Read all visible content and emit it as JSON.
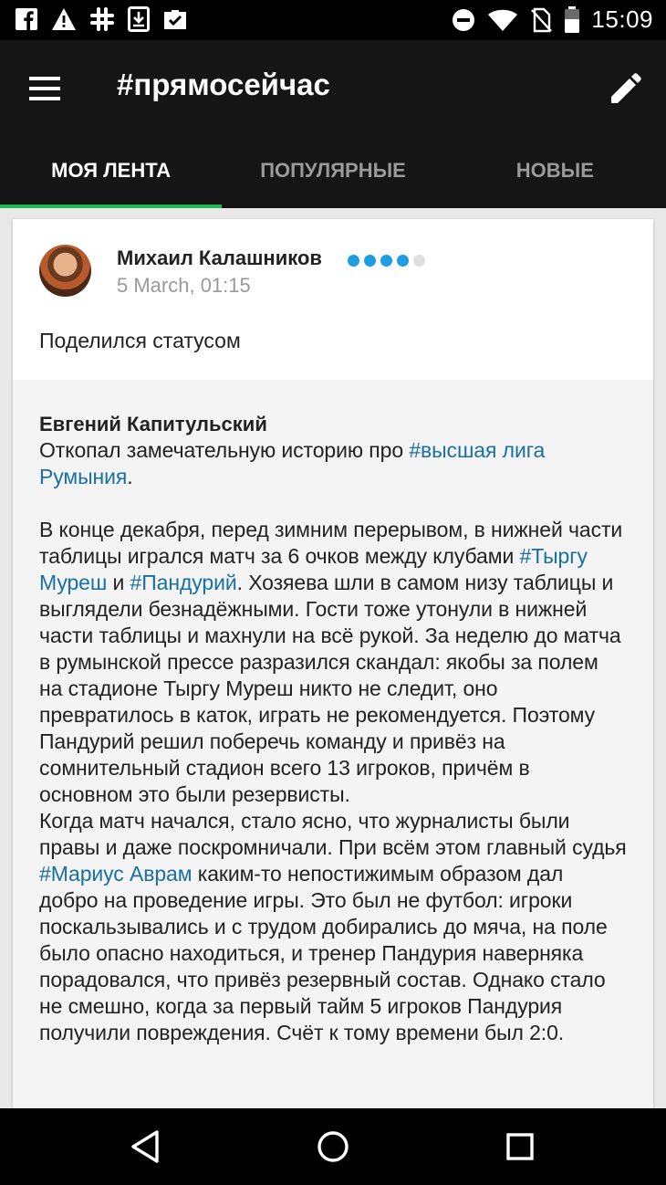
{
  "status_bar": {
    "time": "15:09",
    "left_icons": [
      "facebook-icon",
      "alert-icon",
      "slack-icon",
      "download-icon",
      "briefcase-check-icon"
    ],
    "right_icons": [
      "do-not-disturb-icon",
      "wifi-icon",
      "no-sim-icon",
      "battery-icon"
    ]
  },
  "app_bar": {
    "title": "#прямосейчас"
  },
  "tabs": [
    {
      "label": "МОЯ ЛЕНТА",
      "active": true
    },
    {
      "label": "ПОПУЛЯРНЫЕ",
      "active": false
    },
    {
      "label": "НОВЫЕ",
      "active": false
    }
  ],
  "post": {
    "author": "Михаил Калашников",
    "rating": {
      "filled": 4,
      "total": 5
    },
    "time": "5 March, 01:15",
    "action": "Поделился статусом",
    "quoted": {
      "author": "Евгений Капитульский",
      "intro_before": "Откопал замечательную историю про ",
      "intro_tag": "#высшая лига Румыния",
      "intro_after": ".",
      "p1_a": "В конце декабря, перед зимним перерывом, в нижней части таблицы игрался матч за 6 очков между клубами ",
      "p1_tag1": "#Тыргу Муреш",
      "p1_b": " и ",
      "p1_tag2": "#Пандурий",
      "p1_c": ". Хозяева шли в самом низу таблицы и выглядели безнадёжными. Гости тоже утонули в нижней части таблицы и махнули на всё рукой. За неделю до матча в румынской прессе разразился скандал: якобы за полем на стадионе Тыргу Муреш никто не следит, оно превратилось в каток, играть не рекомендуется. Поэтому Пандурий решил поберечь команду и привёз на сомнительный стадион всего 13 игроков, причём в основном это были резервисты.",
      "p2_a": "Когда матч начался, стало ясно, что журналисты были правы и даже поскромничали. При всём этом главный судья ",
      "p2_tag": "#Мариус Аврам",
      "p2_b": " каким-то непостижимым образом дал добро на проведение игры. Это был не футбол: игроки поскальзывались и с трудом добирались до мяча, на поле было опасно находиться, и тренер Пандурия наверняка порадовался, что привёз резервный состав. Однако стало не смешно, когда за первый тайм 5 игроков Пандурия получили повреждения. Счёт к тому времени был 2:0."
    }
  },
  "nav_bar": {
    "buttons": [
      "back-icon",
      "home-icon",
      "recents-icon"
    ]
  }
}
